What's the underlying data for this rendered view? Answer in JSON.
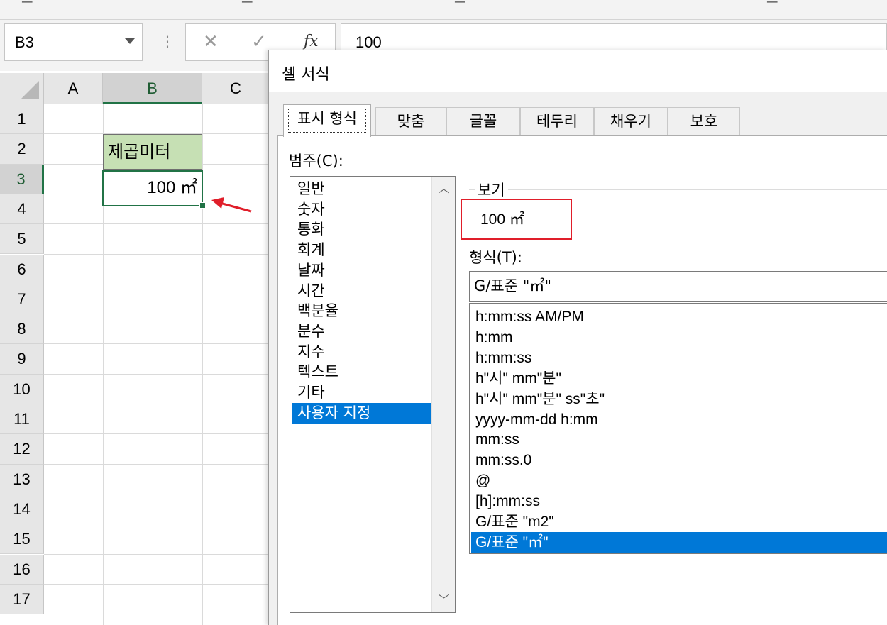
{
  "formula_bar": {
    "name_box": "B3",
    "cancel_icon": "✕",
    "enter_icon": "✓",
    "fx_label": "fx",
    "value": "100"
  },
  "sheet": {
    "columns": [
      "A",
      "B",
      "C"
    ],
    "rows": [
      "1",
      "2",
      "3",
      "4",
      "5",
      "6",
      "7",
      "8",
      "9",
      "10",
      "11",
      "12",
      "13",
      "14",
      "15",
      "16",
      "17"
    ],
    "selected_column": "B",
    "selected_row": "3",
    "cell_b2": "제곱미터",
    "cell_b2_fill": "#c6e0b4",
    "cell_b3": "100 ㎡",
    "accent": "#217346"
  },
  "annotation": {
    "arrow_color": "#e01e2a",
    "highlight_color": "#e01e2a"
  },
  "dialog": {
    "title": "셀 서식",
    "tabs": [
      "표시 형식",
      "맞춤",
      "글꼴",
      "테두리",
      "채우기",
      "보호"
    ],
    "active_tab": "표시 형식",
    "category_label": "범주(C):",
    "categories": [
      "일반",
      "숫자",
      "통화",
      "회계",
      "날짜",
      "시간",
      "백분율",
      "분수",
      "지수",
      "텍스트",
      "기타",
      "사용자 지정"
    ],
    "selected_category": "사용자 지정",
    "sample_label": "보기",
    "sample_value": "100 ㎡",
    "type_label": "형식(T):",
    "type_value": "G/표준 \"㎡\"",
    "formats": [
      "h:mm:ss AM/PM",
      "h:mm",
      "h:mm:ss",
      "h\"시\" mm\"분\"",
      "h\"시\" mm\"분\" ss\"초\"",
      "yyyy-mm-dd h:mm",
      "mm:ss",
      "mm:ss.0",
      "@",
      "[h]:mm:ss",
      "G/표준 \"m2\"",
      "G/표준 \"㎡\""
    ],
    "selected_format": "G/표준 \"㎡\"",
    "selection_color": "#0078d7"
  }
}
